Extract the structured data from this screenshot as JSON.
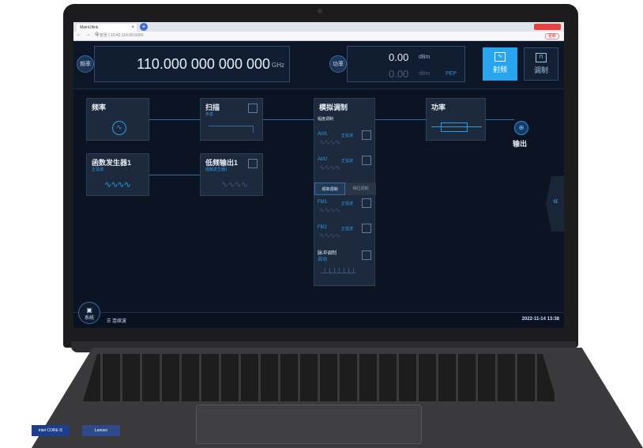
{
  "browser": {
    "tab_title": "MainUIlink",
    "tab_close": "×",
    "new_tab": "+",
    "url": "不安全 | 10.42.114.66:6060",
    "nav": "← → C",
    "account_badge": "更新"
  },
  "topbar": {
    "freq_button": "频率",
    "freq_value": "110.000 000 000 000",
    "freq_unit": "GHz",
    "power_button": "功率",
    "power_value": "0.00",
    "power_unit": "dBm",
    "pep_value": "0.00",
    "pep_unit": "dBm",
    "pep_label": "PEP",
    "rf_button": "射频",
    "mod_button": "调制"
  },
  "blocks": {
    "freq": {
      "title": "频率"
    },
    "sweep": {
      "title": "扫描",
      "sub": "步进"
    },
    "func_gen": {
      "title": "函数发生器1",
      "sub": "正弦波",
      "wave": "∿∿∿∿"
    },
    "lf_out": {
      "title": "低频输出1",
      "sub": "函数发生器1",
      "wave": "∿∿∿∿"
    },
    "analog_mod": {
      "title": "模拟调制",
      "section_am": "幅度调制",
      "am1_label": "AM1",
      "am1_kind": "正弦波",
      "am2_label": "AM2",
      "am2_kind": "正弦波",
      "tab_fm": "频率调制",
      "tab_pm": "相位调制",
      "fm1_label": "FM1",
      "fm1_kind": "正弦波",
      "fm2_label": "FM2",
      "fm2_kind": "正弦波",
      "pulse_label": "脉冲调制",
      "pulse_kind": "自动",
      "wave": "∿∿∿∿"
    },
    "power": {
      "title": "功率"
    },
    "output": {
      "label": "输出"
    }
  },
  "side_handle": "«",
  "statusbar": {
    "sys_button": "系统",
    "status": "☰ 连续波",
    "time": "2022-11-14 13:38"
  },
  "stickers": {
    "s1": "intel CORE i5",
    "s2": "Lenovo"
  }
}
